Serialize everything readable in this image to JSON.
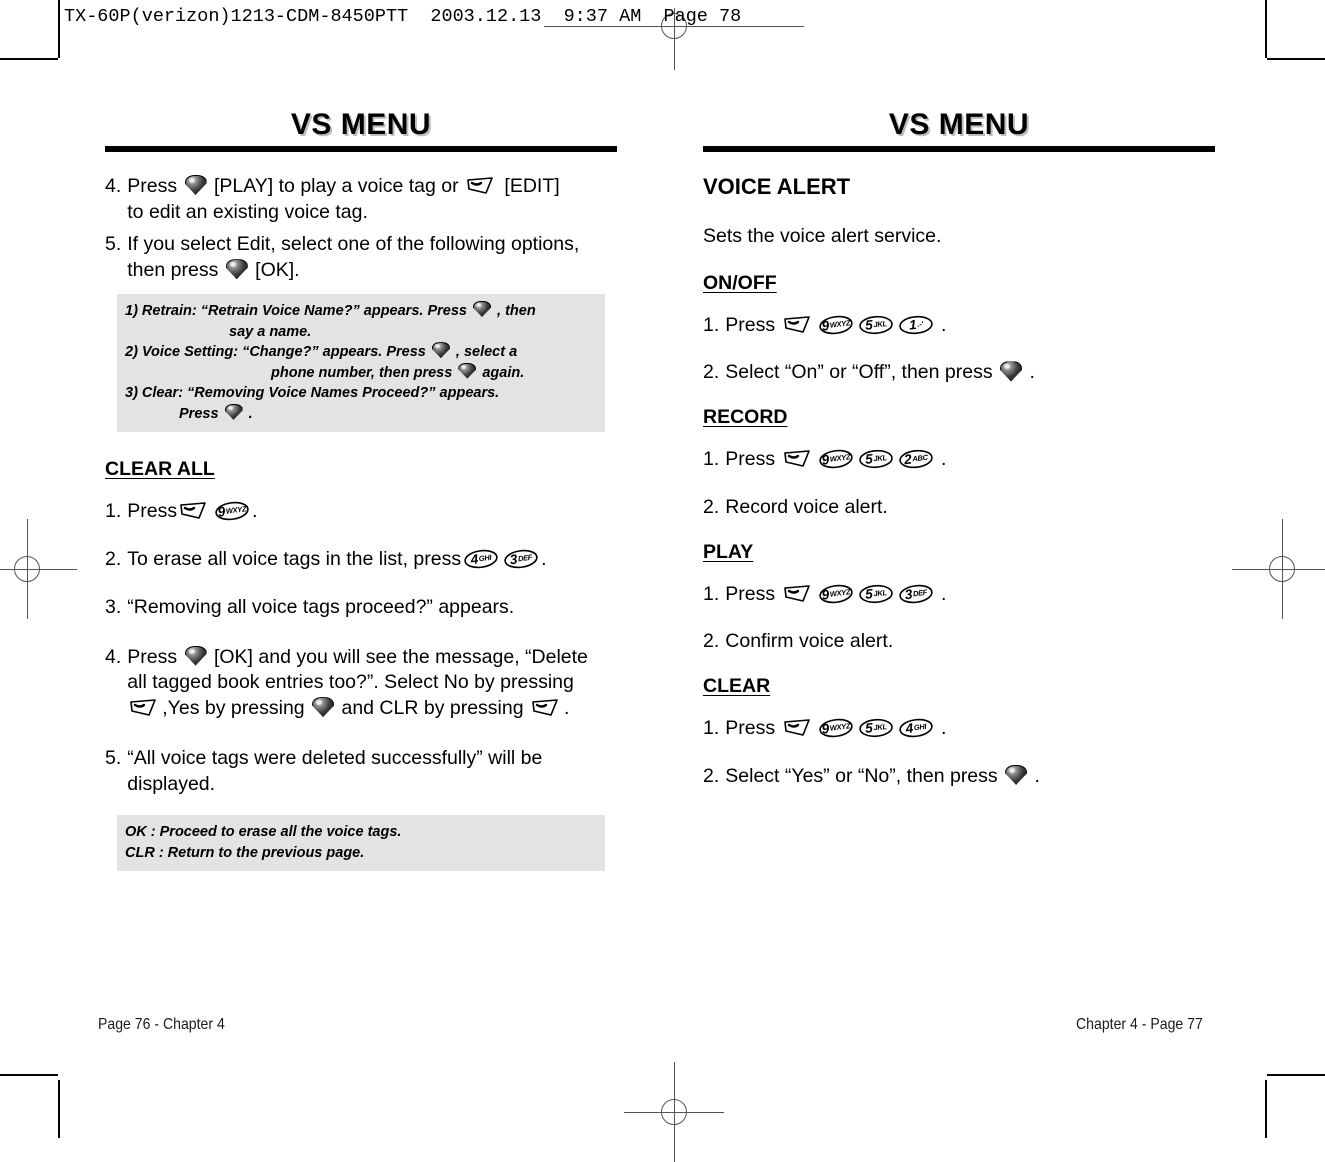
{
  "slug": "TX-60P(verizon)1213-CDM-8450PTT  2003.12.13  9:37 AM  Page 78",
  "left_page": {
    "title": "VS MENU",
    "steps_top": [
      {
        "num": "4.",
        "text": "Press [OK-KEY] [PLAY] to play a voice tag or [CLR-KEY] [EDIT] to edit an existing voice tag.",
        "parts": [
          "Press ",
          " [PLAY] to play a voice tag or ",
          " [EDIT]",
          "to edit an existing voice tag."
        ]
      },
      {
        "num": "5.",
        "text": "If you select Edit, select one of the following options, then press [OK-KEY] [OK]."
      }
    ],
    "step4_a": "Press",
    "step4_b": "[PLAY] to play a voice tag or",
    "step4_c": "[EDIT]",
    "step4_d": "to edit an existing voice tag.",
    "step5_a": "If you select Edit, select one of the following options,",
    "step5_b": "then press",
    "step5_c": "[OK].",
    "notebox_top": [
      {
        "indent": 0,
        "pre": "1) Retrain: “Retrain Voice Name?” appears. Press",
        "post": ", then"
      },
      {
        "indent": 1,
        "pre": "say a name.",
        "post": ""
      },
      {
        "indent": 0,
        "pre": "2) Voice Setting: “Change?” appears. Press",
        "post": ", select a"
      },
      {
        "indent": 2,
        "pre": "phone number, then press",
        "post": "again."
      },
      {
        "indent": 0,
        "pre": "3) Clear: “Removing Voice Names Proceed?” appears.",
        "post": ""
      },
      {
        "indent": 3,
        "pre": "Press",
        "post": "."
      }
    ],
    "clear_all_heading": "CLEAR ALL",
    "clear_all": {
      "s1_num": "1.",
      "s1_a": "Press",
      "s1_end": ".",
      "s2_num": "2.",
      "s2_a": "To erase all voice tags in the list, press",
      "s2_end": ".",
      "s3_num": "3.",
      "s3_a": "“Removing all voice tags proceed?” appears.",
      "s4_num": "4.",
      "s4_l1a": "Press",
      "s4_l1b": "[OK] and you will see the message, “Delete",
      "s4_l2": "all tagged book entries too?”.  Select No by pressing",
      "s4_l3a": ",Yes by pressing",
      "s4_l3b": "and CLR by pressing",
      "s4_l3c": ".",
      "s5_num": "5.",
      "s5_l1": "“All voice tags were deleted successfully” will be",
      "s5_l2": "displayed."
    },
    "notebox_bottom": [
      "OK : Proceed to erase all the voice tags.",
      "CLR : Return to the previous page."
    ],
    "footer": "Page 76 - Chapter 4"
  },
  "right_page": {
    "title": "VS MENU",
    "section_heading": "VOICE ALERT",
    "section_desc": "Sets the voice alert service.",
    "onoff": {
      "heading": "ON/OFF",
      "s1_num": "1.",
      "s1_a": "Press",
      "s1_end": ".",
      "s1_keys": [
        "CLR",
        "9",
        "5",
        "1"
      ],
      "s2_num": "2.",
      "s2_a": "Select “On” or “Off”, then press",
      "s2_end": "."
    },
    "record": {
      "heading": "RECORD",
      "s1_num": "1.",
      "s1_a": "Press",
      "s1_end": ".",
      "s1_keys": [
        "CLR",
        "9",
        "5",
        "2"
      ],
      "s2_num": "2.",
      "s2_a": "Record voice alert."
    },
    "play": {
      "heading": "PLAY",
      "s1_num": "1.",
      "s1_a": "Press",
      "s1_end": ".",
      "s1_keys": [
        "CLR",
        "9",
        "5",
        "3"
      ],
      "s2_num": "2.",
      "s2_a": "Confirm voice alert."
    },
    "clear": {
      "heading": "CLEAR",
      "s1_num": "1.",
      "s1_a": "Press",
      "s1_end": ".",
      "s1_keys": [
        "CLR",
        "9",
        "5",
        "4"
      ],
      "s2_num": "2.",
      "s2_a": "Select “Yes” or “No”, then press",
      "s2_end": "."
    },
    "footer": "Chapter 4 - Page 77"
  },
  "keys": {
    "k1": {
      "digit": "1",
      "letters": ".-'"
    },
    "k2": {
      "digit": "2",
      "letters": "ABC"
    },
    "k3": {
      "digit": "3",
      "letters": "DEF"
    },
    "k4": {
      "digit": "4",
      "letters": "GHI"
    },
    "k5": {
      "digit": "5",
      "letters": "JKL"
    },
    "k9": {
      "digit": "9",
      "letters": "WXYZ"
    }
  },
  "colors": {
    "note_box_bg": "#e3e3e3",
    "title_shadow": "#bdbdbd",
    "ink": "#000000",
    "reg_mark": "#555555"
  }
}
